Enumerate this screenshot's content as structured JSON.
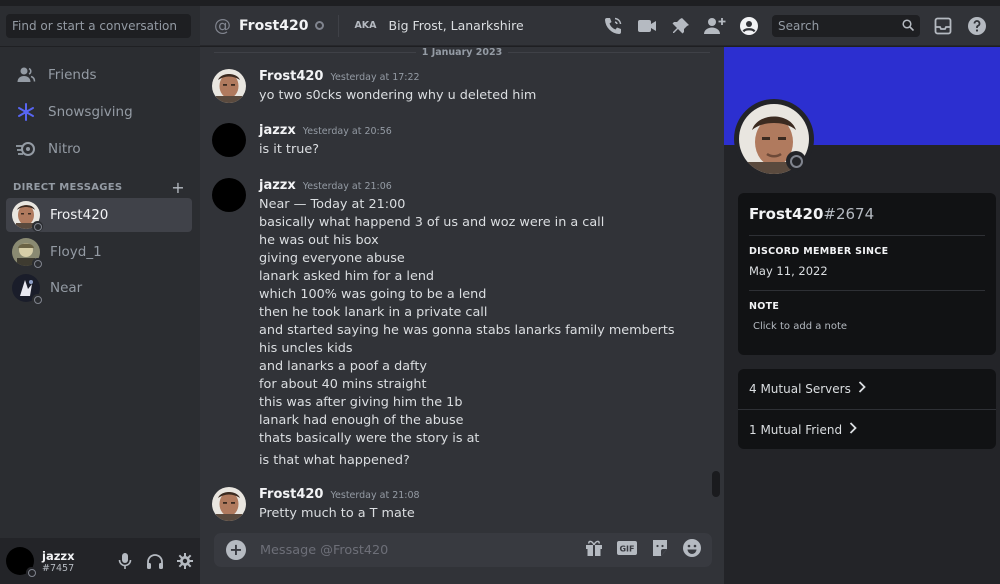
{
  "sidebar": {
    "search_placeholder": "Find or start a conversation",
    "nav": [
      {
        "label": "Friends",
        "icon": "friends-icon"
      },
      {
        "label": "Snowsgiving",
        "icon": "snowflake-icon"
      },
      {
        "label": "Nitro",
        "icon": "nitro-icon"
      }
    ],
    "dm_header": "DIRECT MESSAGES",
    "dm_add": "+",
    "dms": [
      {
        "name": "Frost420",
        "active": true
      },
      {
        "name": "Floyd_1",
        "active": false
      },
      {
        "name": "Near",
        "active": false
      }
    ]
  },
  "user_panel": {
    "name": "jazzx",
    "tag": "#7457"
  },
  "header": {
    "at_symbol": "@",
    "channel_name": "Frost420",
    "aka_label": "AKA",
    "aka_names": "Big Frost, Lanarkshire",
    "search_placeholder": "Search"
  },
  "chat": {
    "date_divider": "1 January 2023",
    "messages": [
      {
        "author": "Frost420",
        "time": "Yesterday at 17:22",
        "lines": [
          "yo two s0cks wondering why u deleted him"
        ]
      },
      {
        "author": "jazzx",
        "time": "Yesterday at 20:56",
        "lines": [
          "is it true?"
        ]
      },
      {
        "author": "jazzx",
        "time": "Yesterday at 21:06",
        "lines": [
          "Near — Today at 21:00",
          "basically what happend 3 of us and woz were in a call",
          "he was out his box",
          "giving everyone abuse",
          "lanark asked him for a lend",
          "which 100% was going to be a lend",
          "then he took lanark in a private call",
          "and started saying he was gonna stabs lanarks family memberts",
          "his uncles kids",
          "and lanarks a poof a dafty",
          "for about 40 mins straight",
          "this was after giving him the 1b",
          "lanark had enough of the abuse",
          "thats basically were the story is at"
        ],
        "extra_line": "is that what happened?"
      },
      {
        "author": "Frost420",
        "time": "Yesterday at 21:08",
        "lines": [
          "Pretty much to a T mate"
        ]
      }
    ],
    "composer_placeholder": "Message @Frost420",
    "gif_label": "GIF"
  },
  "profile": {
    "username": "Frost420",
    "discriminator": "#2674",
    "member_since_label": "DISCORD MEMBER SINCE",
    "member_since": "May 11, 2022",
    "note_label": "NOTE",
    "note_placeholder": "Click to add a note",
    "mutual_servers": "4 Mutual Servers",
    "mutual_friends": "1 Mutual Friend",
    "banner_color": "#2c2fd0"
  },
  "colors": {
    "background": "#313338",
    "sidebar": "#2b2d31",
    "panel": "#232428",
    "text": "#dbdee1"
  }
}
